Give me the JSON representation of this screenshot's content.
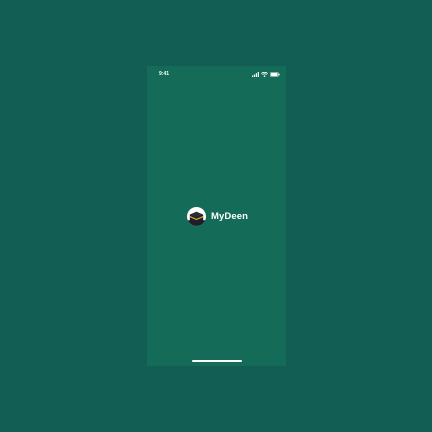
{
  "status_bar": {
    "time": "9:41",
    "icons": [
      "signal-icon",
      "wifi-icon",
      "battery-icon"
    ]
  },
  "splash": {
    "app_name": "MyDeen",
    "logo_icon": "kaaba-logo-icon"
  },
  "colors": {
    "outer_background": "#125e55",
    "screen_background": "#146c58",
    "text": "#ffffff",
    "logo_circle": "#ffffff",
    "logo_cube": "#1d1d2b",
    "logo_band": "#d9a514"
  }
}
